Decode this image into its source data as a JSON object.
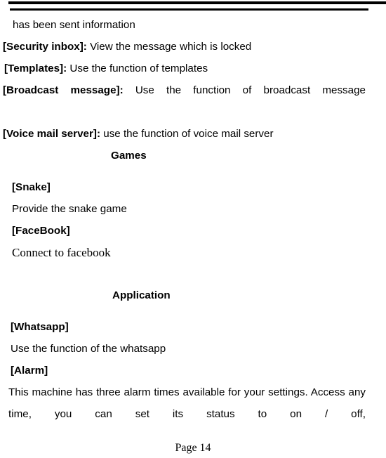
{
  "document": {
    "page_footer": "Page 14",
    "header_rules": 2
  },
  "content": {
    "continued_line": "has been sent information",
    "entries_messaging": [
      {
        "term": "[Security inbox]:",
        "desc": "View the message which is locked"
      },
      {
        "term": "[Templates]:",
        "desc": "Use the function of templates"
      }
    ],
    "broadcast": {
      "term": "[Broadcast message]:",
      "desc": "Use the function of broadcast message"
    },
    "voicemail": {
      "term": "[Voice mail server]:",
      "desc": "use the function of voice mail server"
    },
    "sections": [
      {
        "heading": "Games",
        "items": [
          {
            "term": "[Snake]",
            "desc": "Provide the snake game"
          },
          {
            "term": "[FaceBook]",
            "desc": "Connect to facebook"
          }
        ]
      },
      {
        "heading": "Application",
        "items": [
          {
            "term": "[Whatsapp]",
            "desc": "Use the function of the whatsapp"
          },
          {
            "term": "[Alarm]",
            "desc": "This machine has three alarm times available for your settings. Access any time, you can set its status to on / off,"
          }
        ]
      }
    ]
  }
}
